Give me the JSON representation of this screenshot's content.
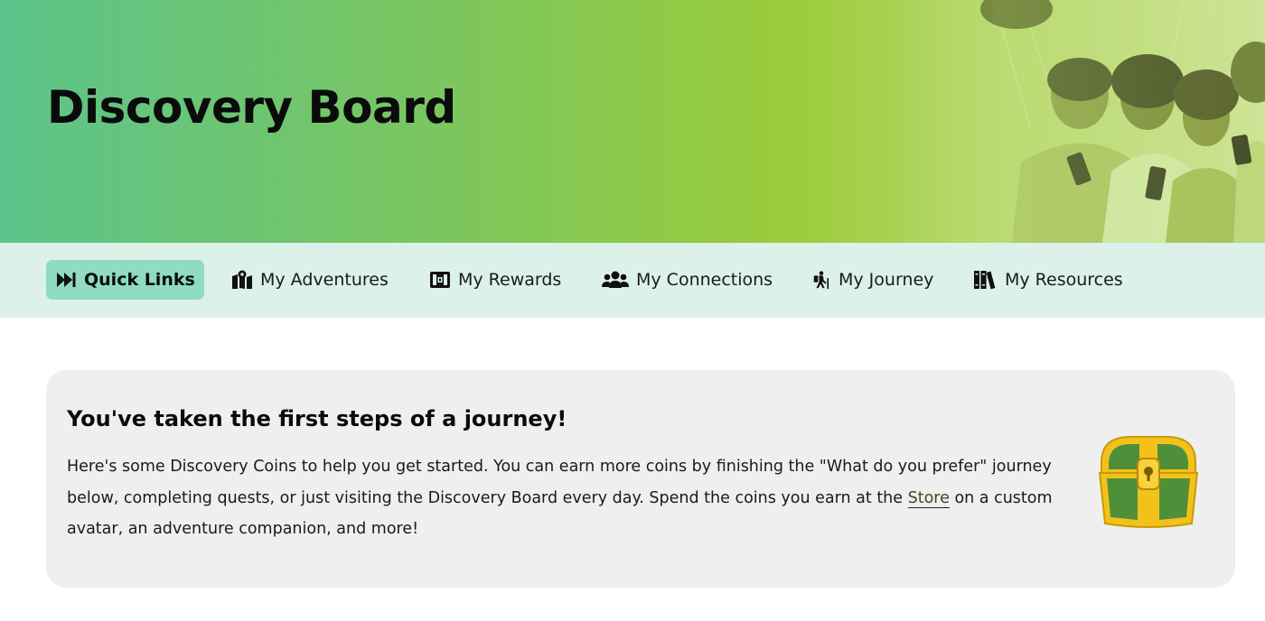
{
  "header": {
    "title": "Discovery Board"
  },
  "nav": {
    "items": [
      {
        "label": "Quick Links",
        "icon": "fast-forward-icon",
        "active": true
      },
      {
        "label": "My Adventures",
        "icon": "map-location-icon",
        "active": false
      },
      {
        "label": "My Rewards",
        "icon": "treasure-chest-icon",
        "active": false
      },
      {
        "label": "My Connections",
        "icon": "users-icon",
        "active": false
      },
      {
        "label": "My Journey",
        "icon": "hiking-icon",
        "active": false
      },
      {
        "label": "My Resources",
        "icon": "books-icon",
        "active": false
      }
    ]
  },
  "welcome_card": {
    "title": "You've taken the first steps of a journey!",
    "body_before_link": "Here's some Discovery Coins to help you get started. You can earn more coins by finishing the \"What do you prefer\" journey below, completing quests, or just visiting the Discovery Board every day. Spend the coins you earn at the ",
    "link_text": "Store",
    "body_after_link": " on a custom avatar, an adventure companion, and more!",
    "image": "treasure-chest-illustration"
  },
  "colors": {
    "hero_gradient_start": "#5cc48a",
    "hero_gradient_end": "#cfe59a",
    "nav_background": "#dcf1e8",
    "nav_active": "#8fdcc0",
    "card_background": "#efefef"
  }
}
